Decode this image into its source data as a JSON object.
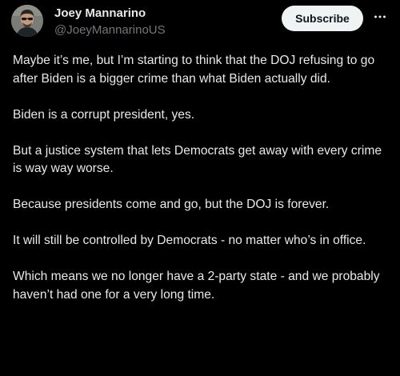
{
  "author": {
    "name": "Joey Mannarino",
    "handle": "@JoeyMannarinoUS",
    "avatar_icon": "profile-photo-avatar"
  },
  "actions": {
    "subscribe_label": "Subscribe",
    "more_icon": "more-options-icon"
  },
  "post": {
    "paragraphs": [
      "Maybe it’s me, but I’m starting to think that the DOJ refusing to go after Biden is a bigger crime than what Biden actually did.",
      "Biden is a corrupt president, yes.",
      "But a justice system that lets Democrats get away with every crime is way way worse.",
      "Because presidents come and go, but the DOJ is forever.",
      "It will still be controlled by Democrats - no matter who’s in office.",
      "Which means we no longer have a 2-party state - and we probably haven’t had one for a very long time."
    ]
  },
  "colors": {
    "background": "#000000",
    "text_primary": "#e7e9ea",
    "text_secondary": "#71767b",
    "button_bg": "#eff3f4",
    "button_text": "#0f1419"
  }
}
